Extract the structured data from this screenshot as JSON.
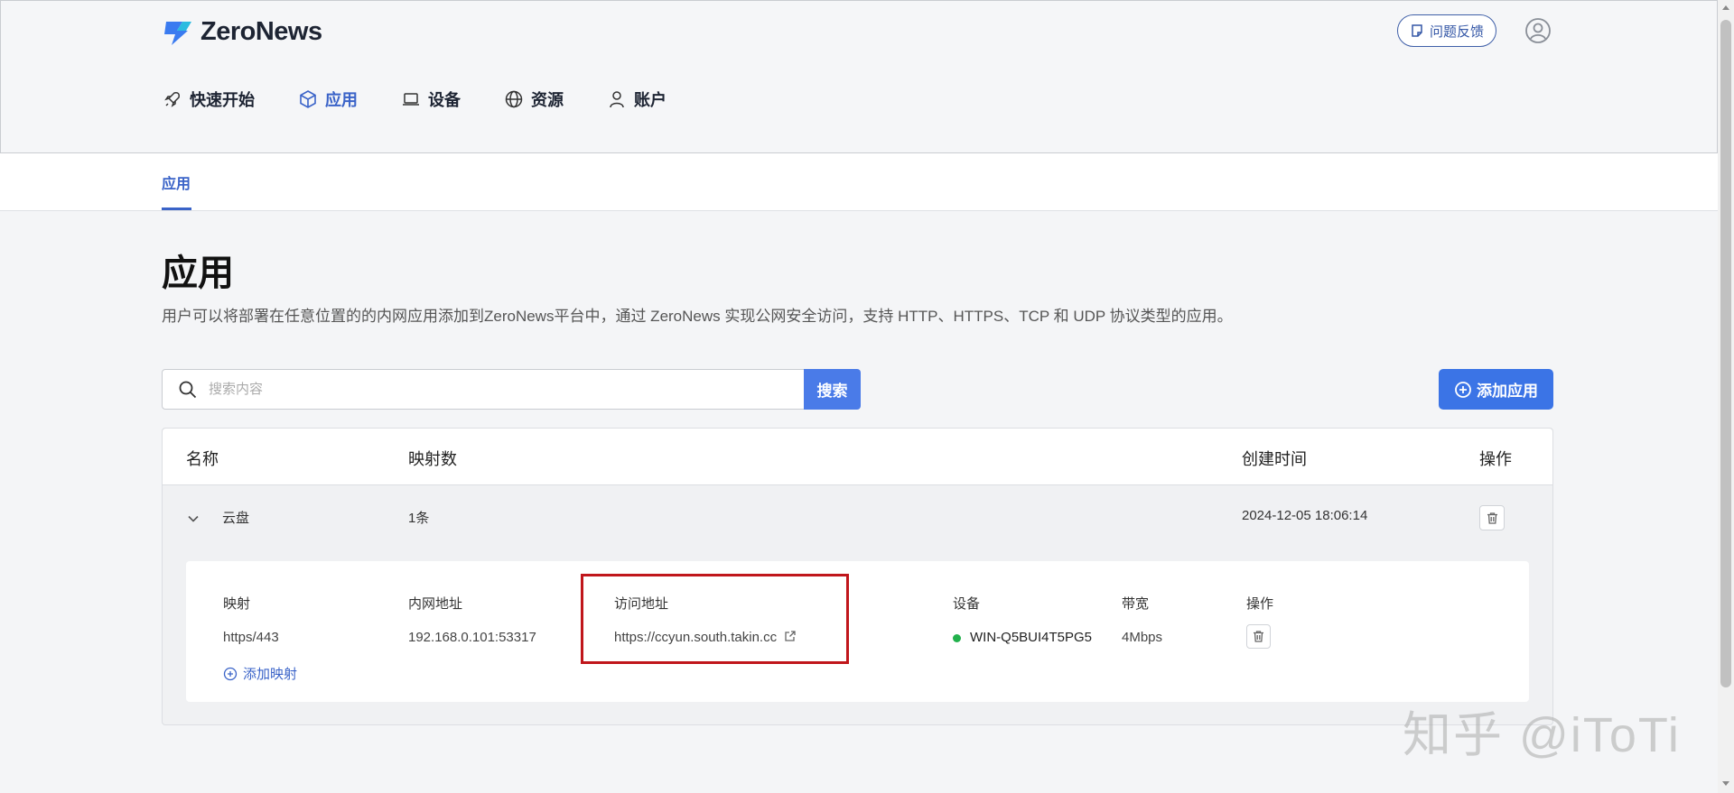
{
  "header": {
    "brand": "ZeroNews",
    "feedback_label": "问题反馈",
    "nav": [
      {
        "label": "快速开始",
        "icon": "rocket-icon"
      },
      {
        "label": "应用",
        "icon": "cube-icon",
        "active": true
      },
      {
        "label": "设备",
        "icon": "laptop-icon"
      },
      {
        "label": "资源",
        "icon": "globe-icon"
      },
      {
        "label": "账户",
        "icon": "user-icon"
      }
    ]
  },
  "subtab": {
    "label": "应用"
  },
  "page": {
    "title": "应用",
    "description": "用户可以将部署在任意位置的的内网应用添加到ZeroNews平台中，通过 ZeroNews 实现公网安全访问，支持 HTTP、HTTPS、TCP 和 UDP 协议类型的应用。"
  },
  "search": {
    "placeholder": "搜索内容",
    "value": "",
    "button_label": "搜索"
  },
  "add_app_label": "添加应用",
  "table": {
    "headers": {
      "name": "名称",
      "mappings": "映射数",
      "created": "创建时间",
      "actions": "操作"
    },
    "rows": [
      {
        "name": "云盘",
        "mappings": "1条",
        "created": "2024-12-05 18:06:14"
      }
    ],
    "detail": {
      "headers": {
        "mapping": "映射",
        "lan_address": "内网地址",
        "access_address": "访问地址",
        "device": "设备",
        "bandwidth": "带宽",
        "actions": "操作"
      },
      "rows": [
        {
          "mapping": "https/443",
          "lan_address": "192.168.0.101:53317",
          "access_address": "https://ccyun.south.takin.cc",
          "device": "WIN-Q5BUI4T5PG5",
          "device_status_color": "#22b14c",
          "bandwidth": "4Mbps"
        }
      ],
      "add_mapping_label": "添加映射"
    }
  },
  "watermark": "知乎 @iToTi",
  "colors": {
    "accent": "#3a63c8",
    "primary_button": "#3b74e6",
    "highlight": "#c0161b"
  }
}
